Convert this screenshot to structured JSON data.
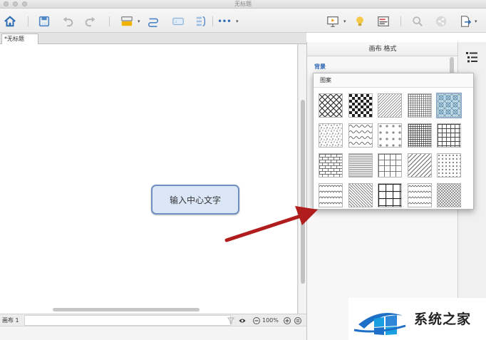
{
  "window": {
    "title": "无标题"
  },
  "toolbar": {
    "items": [
      "home-icon",
      "save-icon",
      "undo-icon",
      "redo-icon",
      "insert-topic-icon",
      "relationship-icon",
      "boundary-icon",
      "summary-icon",
      "more-icon",
      "presentation-icon",
      "idea-icon",
      "outline-icon",
      "search-icon",
      "share-icon",
      "export-icon"
    ],
    "more_label": "•••"
  },
  "document_tab": {
    "label": "*无标题"
  },
  "canvas": {
    "central_topic": "输入中心文字"
  },
  "statusbar": {
    "sheet_label": "画布 1",
    "zoom_level": "100%"
  },
  "panel": {
    "title": "画布 格式",
    "section_background": "背景",
    "pattern_popup": {
      "title": "图案",
      "rows": 4,
      "columns": 5,
      "selected_index": 4,
      "selected_color": "#bcd8e6"
    }
  },
  "watermark": {
    "text": "系统之家"
  },
  "colors": {
    "accent_blue": "#2d66b3",
    "topic_fill": "#dbe6f7",
    "topic_border": "#6f8fc2",
    "arrow_red": "#b11d1d"
  }
}
